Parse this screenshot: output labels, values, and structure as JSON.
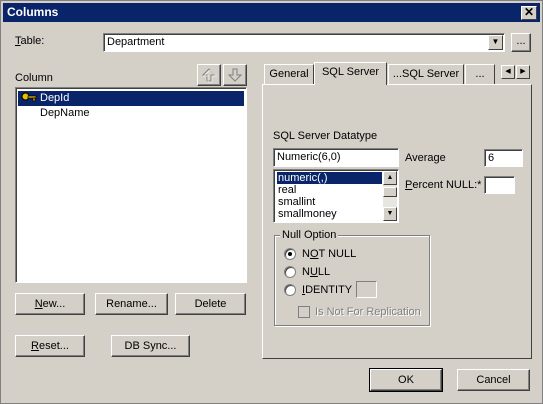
{
  "window": {
    "title": "Columns",
    "close": "✕"
  },
  "table": {
    "label": "Table:",
    "value": "Department",
    "more": "..."
  },
  "column": {
    "label": "Column",
    "items": [
      "DepId",
      "DepName"
    ]
  },
  "tabs": [
    "General",
    "SQL Server",
    "...SQL Server",
    "..."
  ],
  "sql": {
    "datatype_label": "SQL Server Datatype",
    "datatype_value": "Numeric(6,0)",
    "types": [
      "numeric(,)",
      "real",
      "smallint",
      "smallmoney"
    ],
    "average_label": "Average",
    "average_value": "6",
    "percent_null_label": "Percent NULL:*",
    "percent_null_value": ""
  },
  "null_option": {
    "label": "Null Option",
    "not_null": "NOT NULL",
    "null": "NULL",
    "identity": "IDENTITY",
    "replication": "Is Not For Replication"
  },
  "buttons": {
    "new": "New...",
    "rename": "Rename...",
    "delete": "Delete",
    "reset": "Reset...",
    "dbsync": "DB Sync...",
    "ok": "OK",
    "cancel": "Cancel"
  }
}
